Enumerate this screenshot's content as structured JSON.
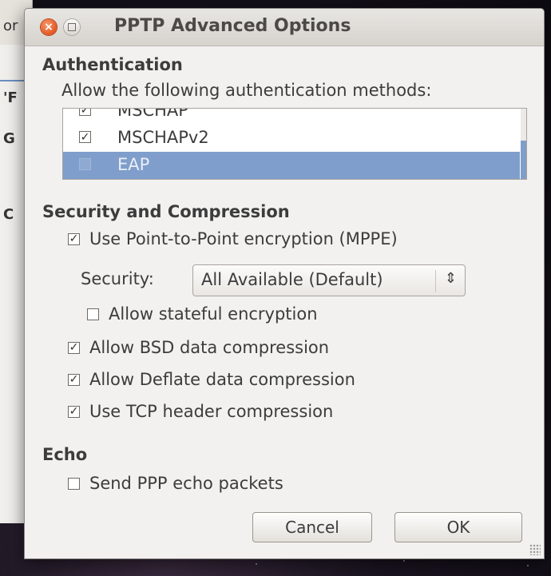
{
  "window": {
    "title": "PPTP Advanced Options"
  },
  "background_fragments": [
    "or",
    "'F",
    "G",
    "C"
  ],
  "authentication": {
    "heading": "Authentication",
    "prompt": "Allow the following authentication methods:",
    "methods": [
      {
        "label": "MSCHAP",
        "checked": true,
        "selected": false
      },
      {
        "label": "MSCHAPv2",
        "checked": true,
        "selected": false
      },
      {
        "label": "EAP",
        "checked": false,
        "selected": true
      }
    ]
  },
  "security": {
    "heading": "Security and Compression",
    "use_mppe": {
      "label": "Use Point-to-Point encryption (MPPE)",
      "checked": true
    },
    "security_label": "Security:",
    "security_value": "All Available (Default)",
    "stateful": {
      "label": "Allow stateful encryption",
      "checked": false
    },
    "bsd": {
      "label": "Allow BSD data compression",
      "checked": true
    },
    "deflate": {
      "label": "Allow Deflate data compression",
      "checked": true
    },
    "tcp_header": {
      "label": "Use TCP header compression",
      "checked": true
    }
  },
  "echo": {
    "heading": "Echo",
    "send_echo": {
      "label": "Send PPP echo packets",
      "checked": false
    }
  },
  "buttons": {
    "cancel": "Cancel",
    "ok": "OK"
  },
  "icons": {
    "close": "close-icon",
    "maximize": "maximize-icon",
    "checkmark": "checkmark-icon",
    "combo": "updown-chevron-icon"
  }
}
